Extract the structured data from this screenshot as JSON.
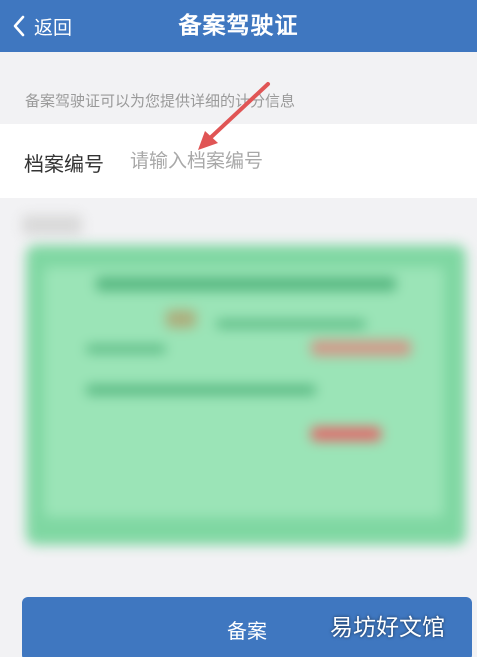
{
  "header": {
    "back_label": "返回",
    "title": "备案驾驶证"
  },
  "hint": "备案驾驶证可以为您提供详细的计分信息",
  "form": {
    "archive_label": "档案编号",
    "archive_placeholder": "请输入档案编号",
    "archive_value": ""
  },
  "submit_label": "备案",
  "watermark": "易坊好文馆",
  "colors": {
    "nav_bg": "#3f77c0",
    "page_bg": "#f2f2f4",
    "arrow": "#e05555"
  }
}
